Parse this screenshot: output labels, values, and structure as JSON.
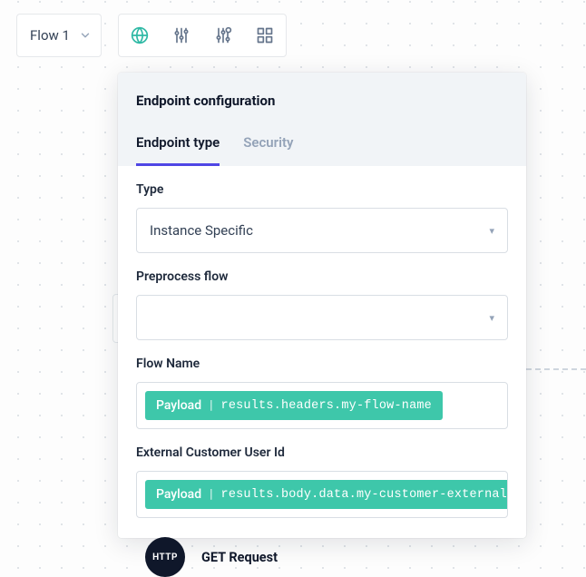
{
  "flow_selector": {
    "label": "Flow 1"
  },
  "toolbar": {
    "items": [
      {
        "name": "globe-icon"
      },
      {
        "name": "sliders-icon"
      },
      {
        "name": "sliders-alt-icon"
      },
      {
        "name": "grid-icon"
      }
    ]
  },
  "panel": {
    "title": "Endpoint configuration",
    "tabs": [
      {
        "label": "Endpoint type",
        "active": true
      },
      {
        "label": "Security",
        "active": false
      }
    ],
    "fields": {
      "type": {
        "label": "Type",
        "value": "Instance Specific"
      },
      "preprocess": {
        "label": "Preprocess flow",
        "value": ""
      },
      "flow_name": {
        "label": "Flow Name",
        "pill_kind": "Payload",
        "pill_path": "results.headers.my-flow-name"
      },
      "external_id": {
        "label": "External Customer User Id",
        "pill_kind": "Payload",
        "pill_path": "results.body.data.my-customer-external-"
      }
    }
  },
  "node": {
    "badge": "HTTP",
    "label": "GET Request"
  }
}
